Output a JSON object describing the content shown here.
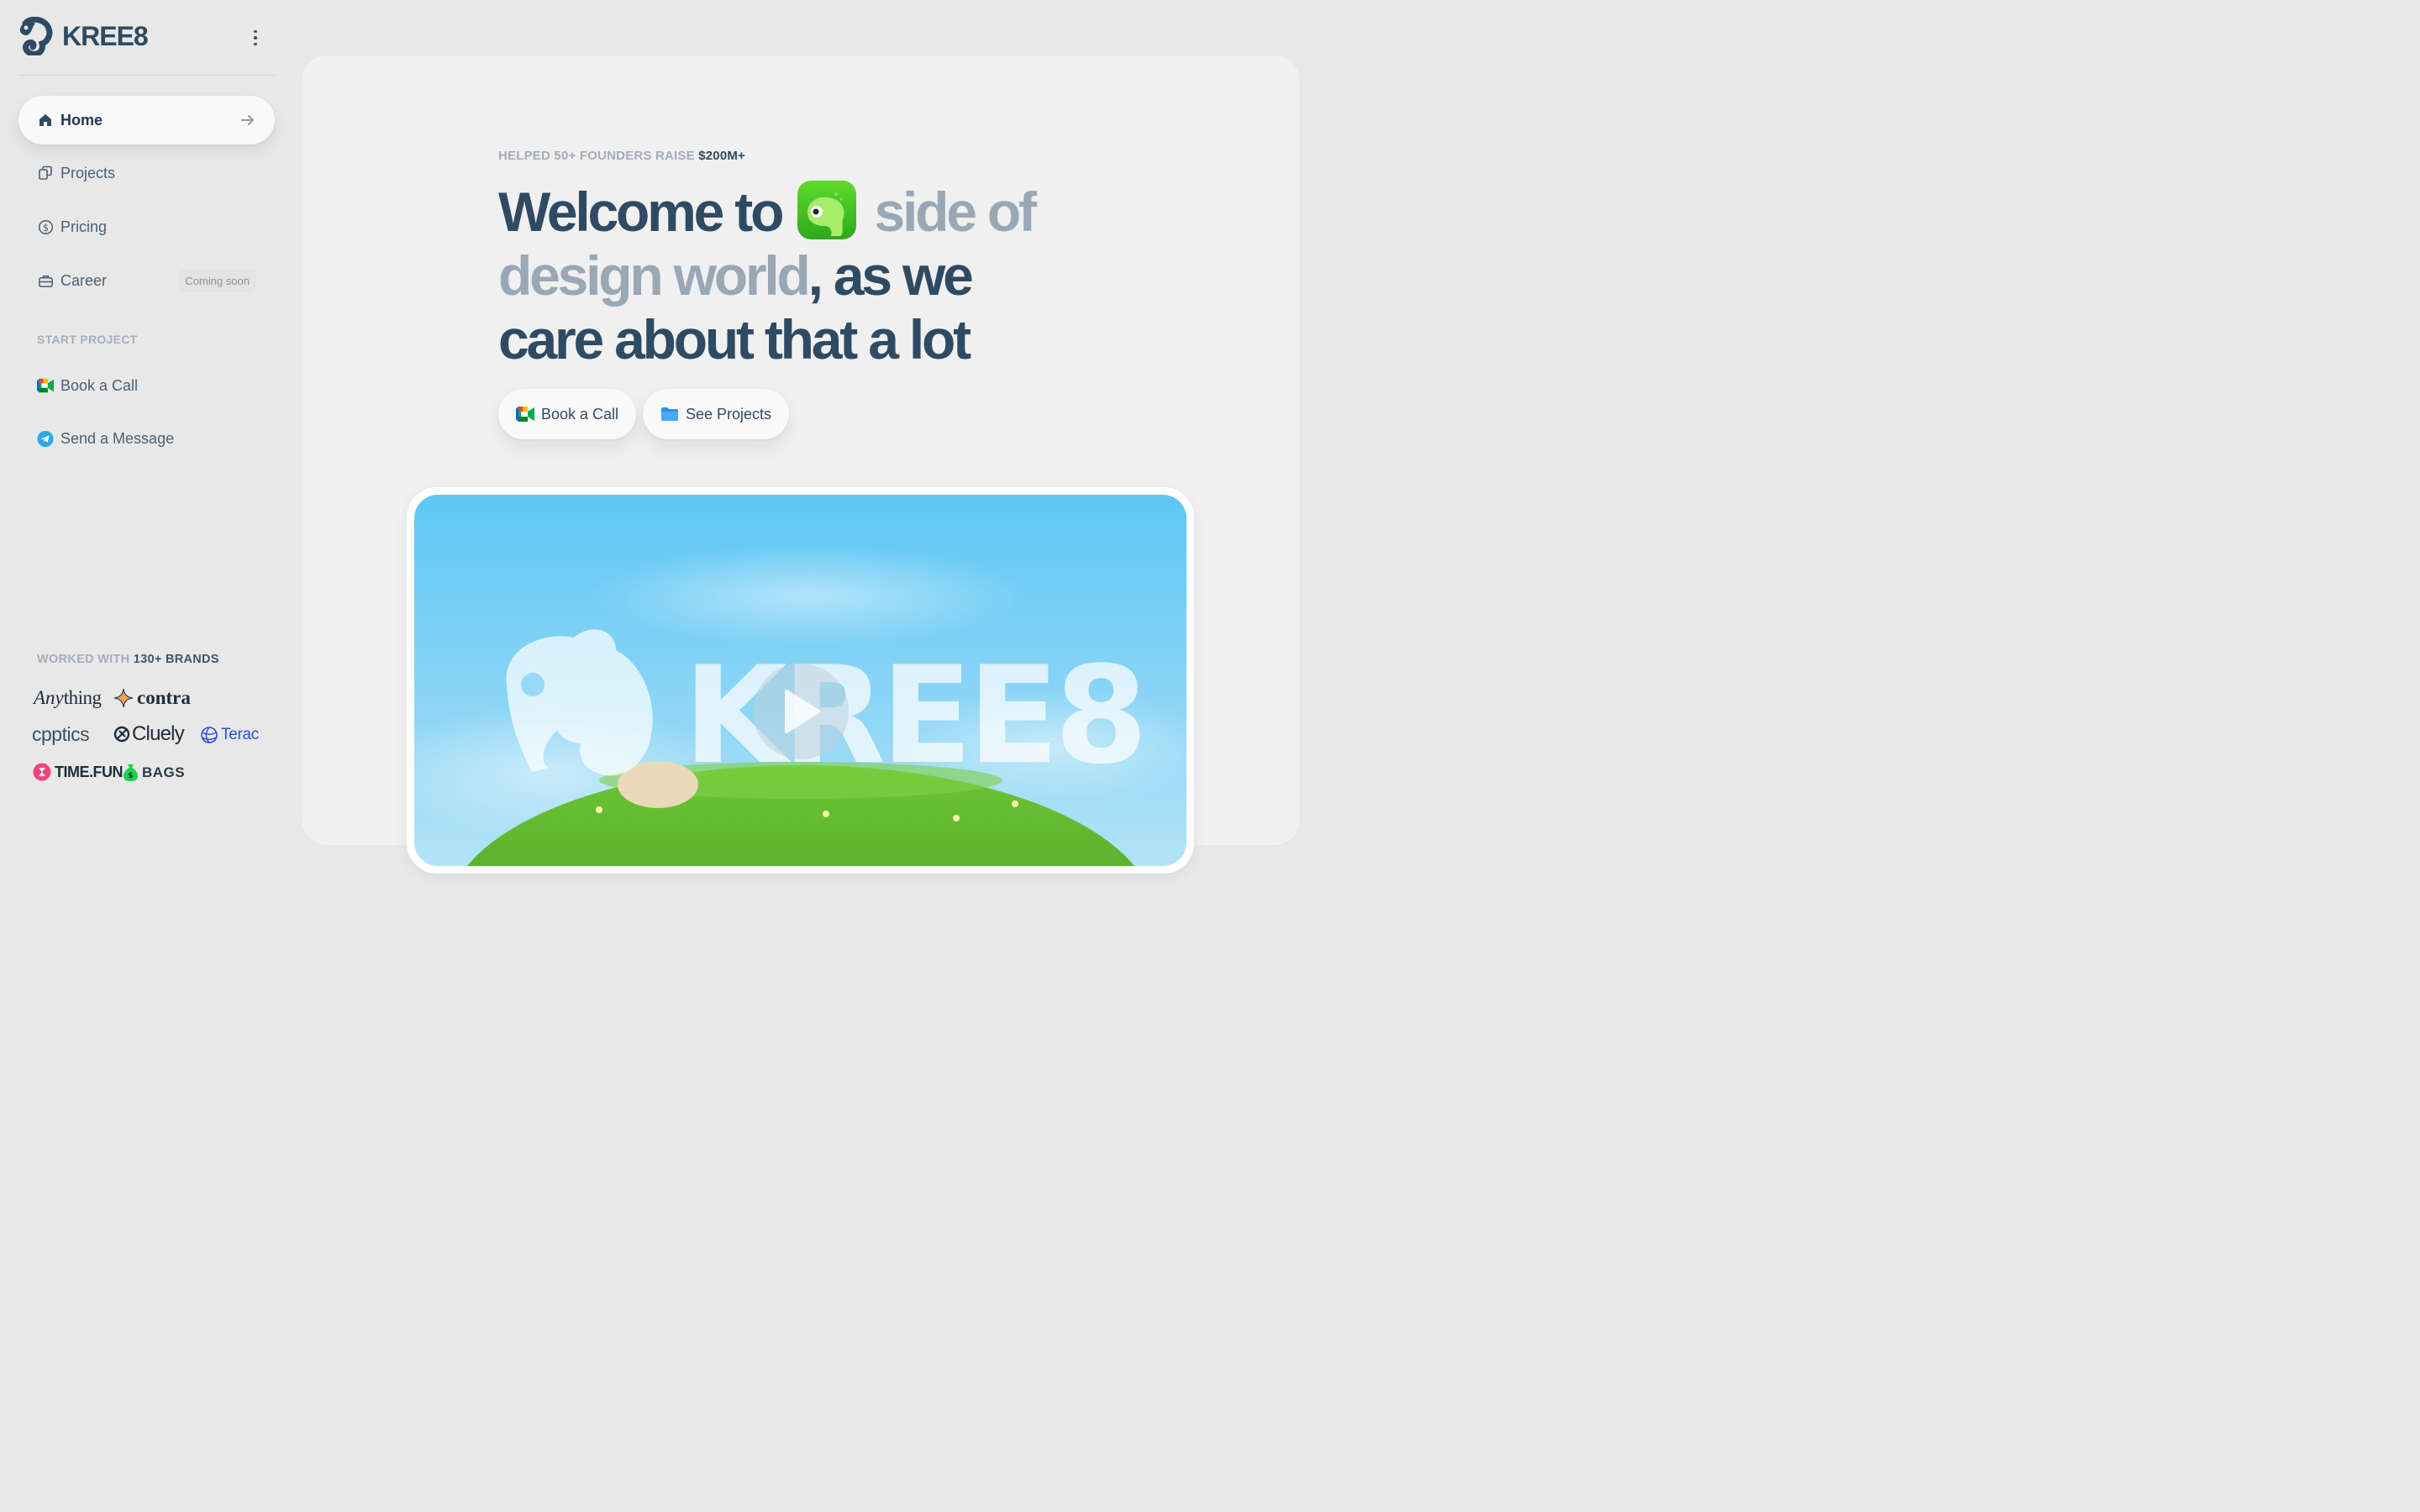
{
  "brand": {
    "name": "KREE8"
  },
  "sidebar": {
    "nav": [
      {
        "label": "Home",
        "icon": "home-icon",
        "active": true
      },
      {
        "label": "Projects",
        "icon": "projects-icon"
      },
      {
        "label": "Pricing",
        "icon": "dollar-circle-icon"
      },
      {
        "label": "Career",
        "icon": "briefcase-icon",
        "badge": "Coming soon"
      }
    ],
    "start_project": {
      "heading": "START PROJECT",
      "items": [
        {
          "label": "Book a Call",
          "icon": "google-meet-icon"
        },
        {
          "label": "Send a Message",
          "icon": "telegram-icon"
        }
      ]
    },
    "brands": {
      "heading_prefix": "WORKED WITH",
      "heading_strong": "130+ BRANDS",
      "logos": [
        {
          "name_part1": "Any",
          "name_part2": "thing"
        },
        {
          "name": "contra"
        },
        {
          "name": "cpptics"
        },
        {
          "name": "Cluely"
        },
        {
          "name": "Terac"
        },
        {
          "name_part1": "TIME",
          "name_part2": ".FUN"
        },
        {
          "name": "BAGS"
        }
      ]
    }
  },
  "main": {
    "eyebrow_prefix": "HELPED 50+ FOUNDERS RAISE",
    "eyebrow_strong": "$200M+",
    "headline": {
      "part1": "Welcome to",
      "part2_muted": "side of design world",
      "part3": ", as we care about that a lot"
    },
    "buttons": [
      {
        "label": "Book a Call",
        "icon": "google-meet-icon"
      },
      {
        "label": "See Projects",
        "icon": "folder-icon"
      }
    ],
    "hero": {
      "overlay_text": "KREE8",
      "play_icon": "play-icon"
    }
  },
  "colors": {
    "ink": "#2f4a63",
    "muted": "#9aa7b5",
    "page": "#e8e8e8",
    "card": "#f0f0f0",
    "sky": "#7fcdf4",
    "grass": "#5fae2c"
  }
}
